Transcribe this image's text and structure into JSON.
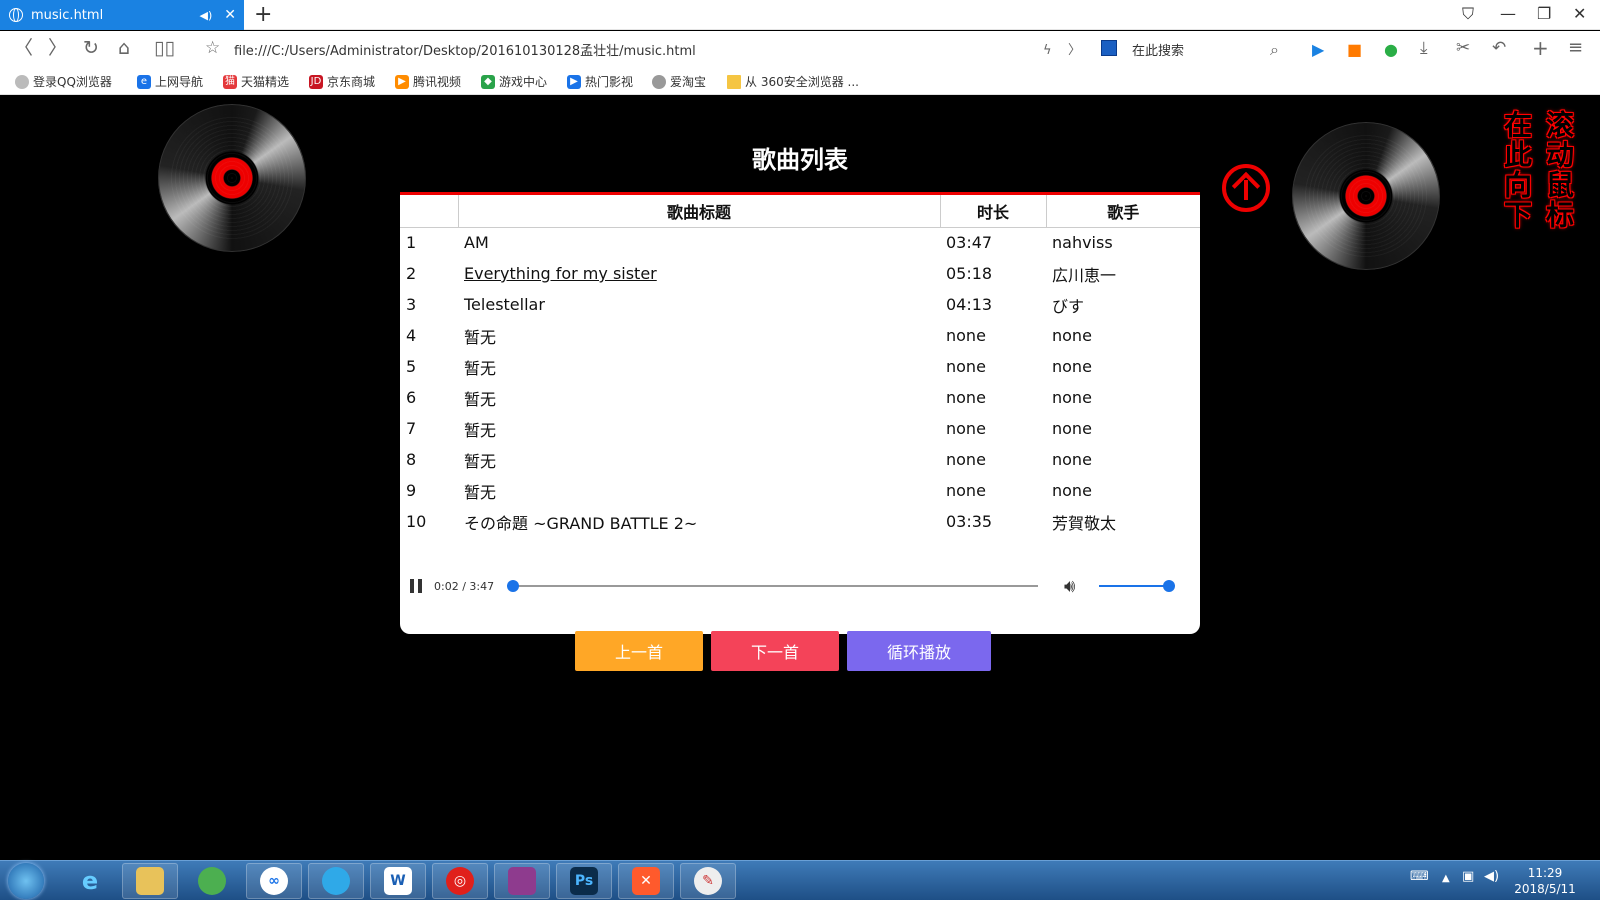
{
  "browser": {
    "tab_title": "music.html",
    "tab_mute_icon": "speaker-mute-icon",
    "address": "file:///C:/Users/Administrator/Desktop/201610130128孟壮壮/music.html",
    "search_placeholder": "在此搜索",
    "bookmarks": [
      {
        "label": "登录QQ浏览器",
        "color": "#888"
      },
      {
        "label": "上网导航",
        "color": "#1a73e8"
      },
      {
        "label": "天猫精选",
        "color": "#e4393c"
      },
      {
        "label": "京东商城",
        "color": "#c81623"
      },
      {
        "label": "腾讯视频",
        "color": "#ff8c00"
      },
      {
        "label": "游戏中心",
        "color": "#2aa34a"
      },
      {
        "label": "热门影视",
        "color": "#1a73e8"
      },
      {
        "label": "爱淘宝",
        "color": "#888"
      },
      {
        "label": "从 360安全浏览器 ...",
        "color": "#f5c542"
      }
    ]
  },
  "page": {
    "heading": "歌曲列表",
    "side_text_1": "在此向下",
    "side_text_2": "滚动鼠标",
    "table": {
      "headers": [
        "",
        "歌曲标题",
        "时长",
        "歌手"
      ],
      "rows": [
        {
          "num": "1",
          "title": "AM",
          "duration": "03:47",
          "artist": "nahviss"
        },
        {
          "num": "2",
          "title": "Everything for my sister",
          "duration": "05:18",
          "artist": "広川恵一"
        },
        {
          "num": "3",
          "title": "Telestellar",
          "duration": "04:13",
          "artist": "びす"
        },
        {
          "num": "4",
          "title": "暂无",
          "duration": "none",
          "artist": "none"
        },
        {
          "num": "5",
          "title": "暂无",
          "duration": "none",
          "artist": "none"
        },
        {
          "num": "6",
          "title": "暂无",
          "duration": "none",
          "artist": "none"
        },
        {
          "num": "7",
          "title": "暂无",
          "duration": "none",
          "artist": "none"
        },
        {
          "num": "8",
          "title": "暂无",
          "duration": "none",
          "artist": "none"
        },
        {
          "num": "9",
          "title": "暂无",
          "duration": "none",
          "artist": "none"
        },
        {
          "num": "10",
          "title": "その命題 ~GRAND BATTLE 2~",
          "duration": "03:35",
          "artist": "芳賀敬太"
        }
      ]
    },
    "player": {
      "time": "0:02 / 3:47",
      "progress": 0.01,
      "volume": 1.0
    },
    "buttons": {
      "prev": "上一首",
      "next": "下一首",
      "loop": "循环播放"
    },
    "colors": {
      "prev": "#ffa726",
      "next": "#f44359",
      "loop": "#7b68ee",
      "accent": "#e00000"
    }
  },
  "taskbar": {
    "time": "11:29",
    "date": "2018/5/11",
    "apps": [
      "ie-icon",
      "explorer-icon",
      "360-icon",
      "baidu-netdisk-icon",
      "qq-browser-icon",
      "word-icon",
      "netease-music-icon",
      "winrar-icon",
      "photoshop-icon",
      "xmind-icon",
      "paint-icon"
    ]
  }
}
